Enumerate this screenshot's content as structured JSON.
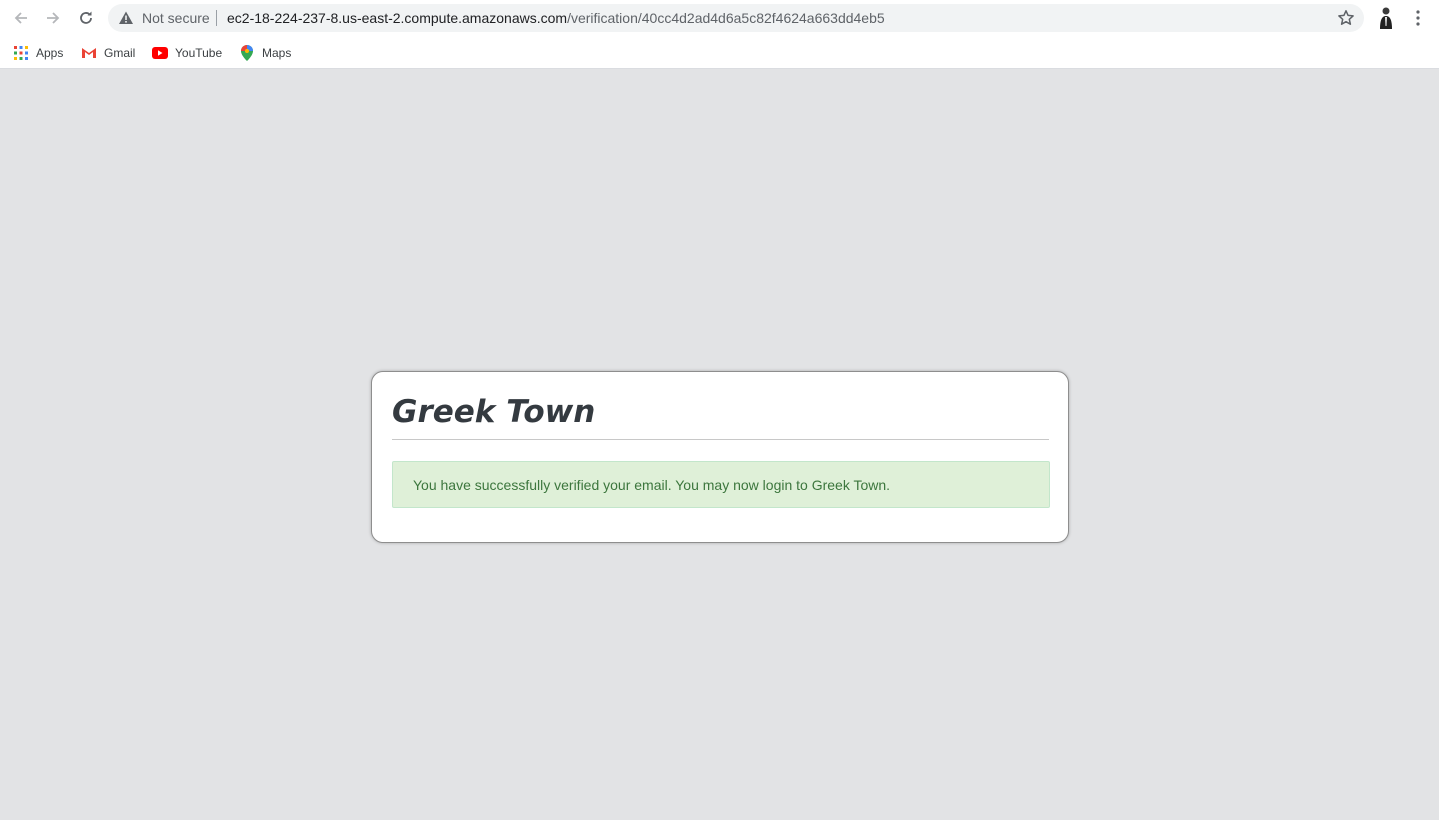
{
  "browser": {
    "security_label": "Not secure",
    "url_host": "ec2-18-224-237-8.us-east-2.compute.amazonaws.com",
    "url_path": "/verification/40cc4d2ad4d6a5c82f4624a663dd4eb5"
  },
  "bookmarks": [
    {
      "label": "Apps",
      "icon": "apps-grid-icon"
    },
    {
      "label": "Gmail",
      "icon": "gmail-icon"
    },
    {
      "label": "YouTube",
      "icon": "youtube-icon"
    },
    {
      "label": "Maps",
      "icon": "maps-icon"
    }
  ],
  "page": {
    "title": "Greek Town",
    "alert_message": "You have successfully verified your email. You may now login to Greek Town."
  },
  "colors": {
    "page_background": "#e2e3e5",
    "alert_background": "#dff0d8",
    "alert_text": "#3c763d",
    "title_text": "#343a40"
  }
}
